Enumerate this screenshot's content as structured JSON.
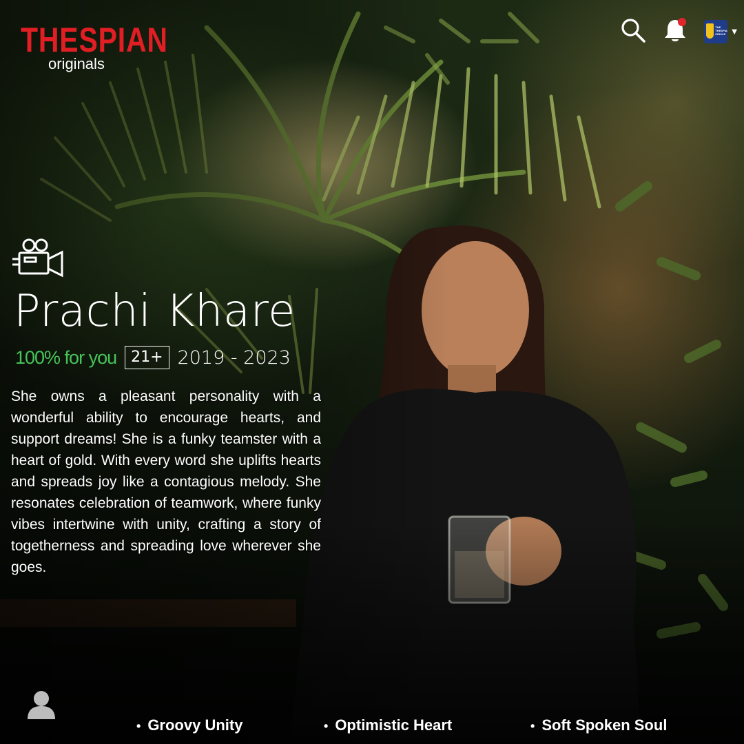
{
  "brand": {
    "name": "THESPIAN",
    "sub": "originals",
    "color": "#e01e24"
  },
  "header": {
    "icons": [
      "search-icon",
      "bell-icon",
      "profile-badge"
    ],
    "notification_dot_color": "#e0262c",
    "profile_badge_text": "THE THESPIAN CIRCLE"
  },
  "hero": {
    "title": "Prachi Khare",
    "match": "100% for you",
    "match_color": "#46c45a",
    "rating": "21+",
    "years": "2019 - 2023",
    "description": "She owns a pleasant personality with a wonderful ability to encourage hearts, and support dreams! She is a funky teamster with a heart of gold. With every word she uplifts hearts and spreads joy like a contagious melody.  She resonates celebration of teamwork, where funky vibes intertwine with unity, crafting a story of togetherness and spreading love wherever she goes."
  },
  "footer": {
    "tags": [
      "Groovy Unity",
      "Optimistic Heart",
      "Soft Spoken Soul"
    ]
  }
}
